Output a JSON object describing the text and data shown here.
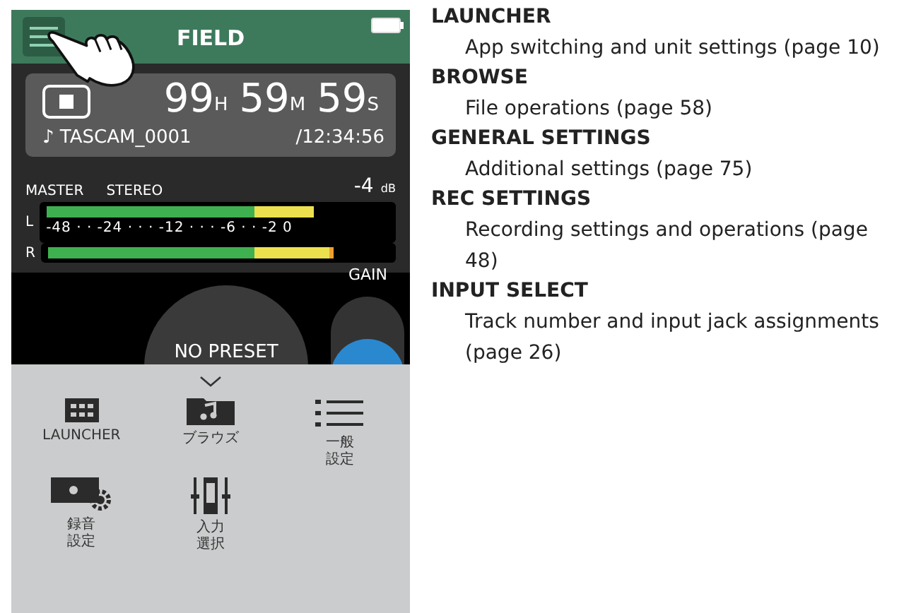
{
  "screen": {
    "header": {
      "title": "FIELD"
    },
    "transport": {
      "hours": "99",
      "hours_unit": "H",
      "minutes": "59",
      "minutes_unit": "M",
      "seconds": "59",
      "seconds_unit": "S",
      "file_name": "♪ TASCAM_0001",
      "total_time": "/12:34:56"
    },
    "meter": {
      "label": "MASTER",
      "mode": "STEREO",
      "reading": "-4",
      "reading_unit": "dB",
      "scale": "-48 · · -24 · · · -12 · · · -6 · · -2 0",
      "channels": [
        {
          "name": "L",
          "level": 0.78
        },
        {
          "name": "R",
          "level": 0.84
        }
      ]
    },
    "gain": {
      "label": "GAIN"
    },
    "preset": {
      "label": "NO PRESET"
    },
    "menu": {
      "items": [
        {
          "kind": "grid",
          "label": "LAUNCHER"
        },
        {
          "kind": "folder",
          "label": "ブラウズ"
        },
        {
          "kind": "list",
          "label": "一般設定"
        },
        {
          "kind": "rec",
          "label": "録音設定"
        },
        {
          "kind": "input",
          "label": "入力選択"
        }
      ]
    }
  },
  "descriptions": [
    {
      "title": "LAUNCHER",
      "text": "App switching and unit settings (page 10)"
    },
    {
      "title": "BROWSE",
      "text": "File operations (page 58)"
    },
    {
      "title": "GENERAL SETTINGS",
      "text": "Additional settings (page 75)"
    },
    {
      "title": "REC SETTINGS",
      "text": "Recording settings and operations (page 48)"
    },
    {
      "title": "INPUT SELECT",
      "text": "Track number and input jack assignments (page 26)"
    }
  ]
}
